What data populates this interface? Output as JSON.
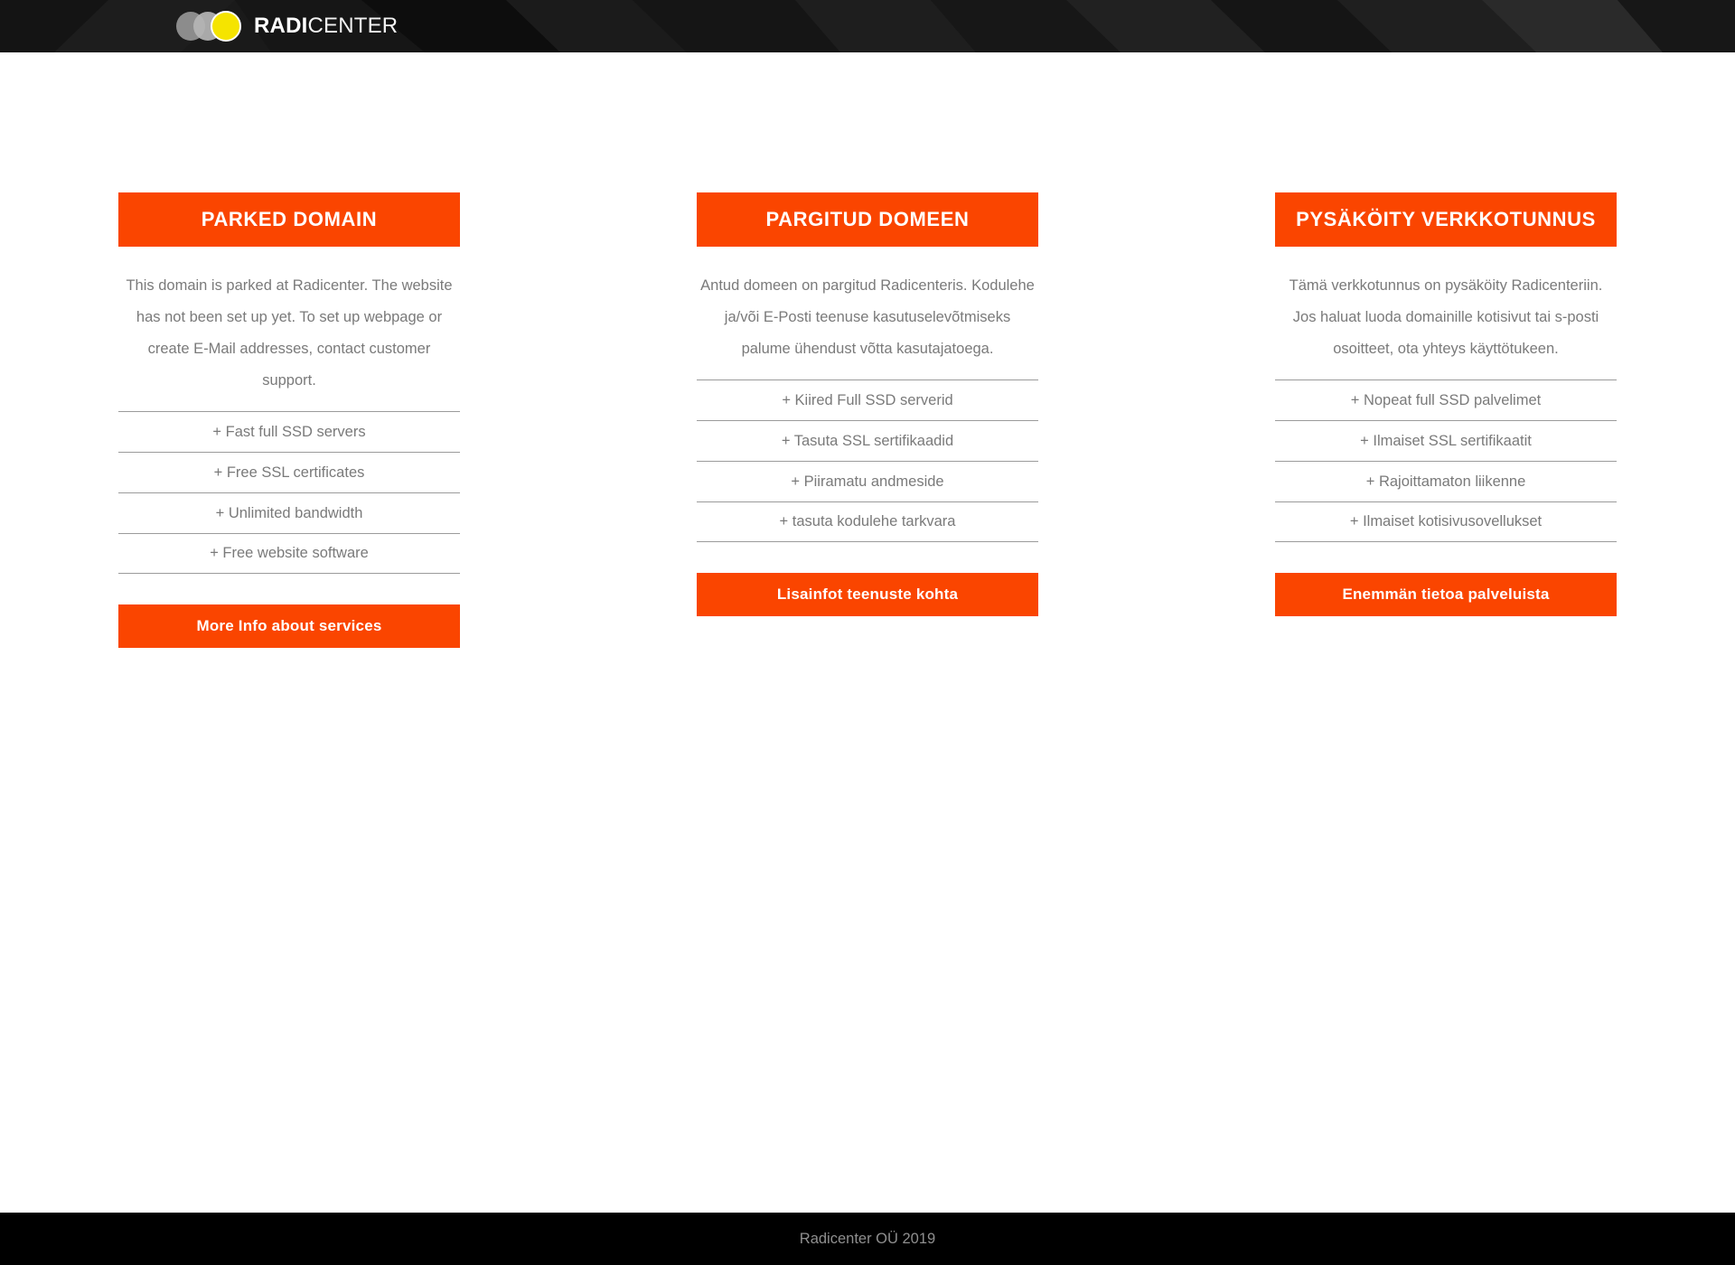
{
  "header": {
    "logo": {
      "bold_part": "RADI",
      "light_part": "CENTER",
      "circle_colors": [
        "#8c8c8c",
        "#b5b5b5",
        "#f5e400"
      ]
    },
    "background_color": "#1a1a1a"
  },
  "theme": {
    "accent": "#fa4500",
    "body_text": "#7a7a7a",
    "divider": "#9b9b9b",
    "footer_bg": "#000000"
  },
  "cards": [
    {
      "title": "PARKED DOMAIN",
      "description": "This domain is parked at Radicenter. The website has not been set up yet. To set up webpage or create E-Mail addresses, contact customer support.",
      "features": [
        "+ Fast full SSD servers",
        "+ Free SSL certificates",
        "+ Unlimited bandwidth",
        "+ Free website software"
      ],
      "cta": "More Info about services"
    },
    {
      "title": "PARGITUD DOMEEN",
      "description": "Antud domeen on pargitud Radicenteris. Kodulehe ja/või E-Posti teenuse kasutuselevõtmiseks palume ühendust võtta kasutajatoega.",
      "features": [
        "+ Kiired Full SSD serverid",
        "+ Tasuta SSL sertifikaadid",
        "+ Piiramatu andmeside",
        "+ tasuta kodulehe tarkvara"
      ],
      "cta": "Lisainfot teenuste kohta"
    },
    {
      "title": "PYSÄKÖITY VERKKOTUNNUS",
      "description": "Tämä verkkotunnus on pysäköity Radicenteriin. Jos haluat luoda domainille kotisivut tai s-posti osoitteet, ota yhteys käyttötukeen.",
      "features": [
        "+ Nopeat full SSD palvelimet",
        "+ Ilmaiset SSL sertifikaatit",
        "+ Rajoittamaton liikenne",
        "+ Ilmaiset kotisivusovellukset"
      ],
      "cta": "Enemmän tietoa palveluista"
    }
  ],
  "footer": {
    "copyright": "Radicenter OÜ 2019"
  }
}
